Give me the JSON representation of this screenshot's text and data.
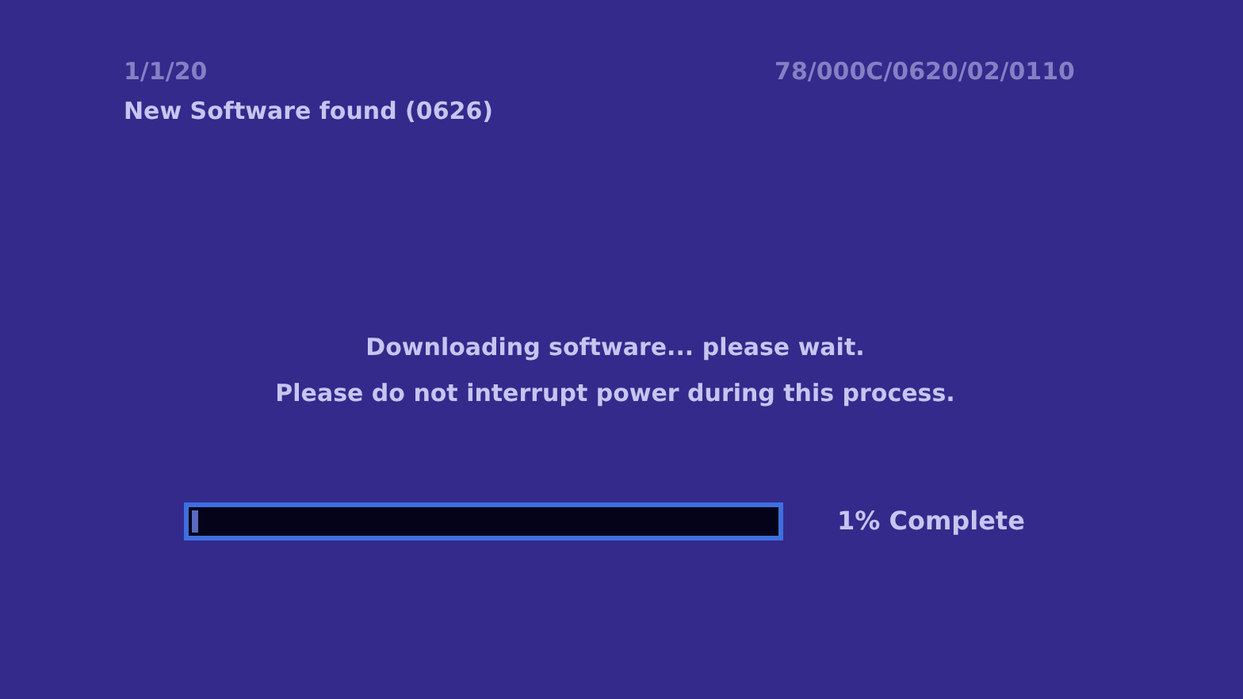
{
  "header": {
    "date": "1/1/20",
    "code": "78/000C/0620/02/0110",
    "title": "New Software found (0626)"
  },
  "message": [
    "Downloading software... please wait.",
    "Please do not interrupt power during this process."
  ],
  "progress": {
    "level": 0.01,
    "reading": "1% Complete"
  }
}
